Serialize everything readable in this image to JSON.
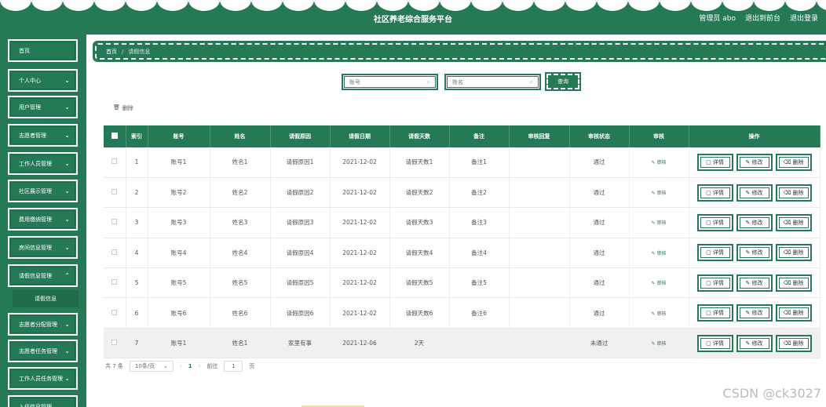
{
  "header": {
    "title": "社区养老综合服务平台",
    "user": "管理员 abo",
    "back": "退出到前台",
    "logout": "退出登录"
  },
  "sidebar": {
    "items": [
      {
        "label": "首页",
        "chev": ""
      },
      {
        "label": "个人中心",
        "chev": "⌄"
      },
      {
        "label": "用户管理",
        "chev": "⌄"
      },
      {
        "label": "志愿者管理",
        "chev": "⌄"
      },
      {
        "label": "工作人员管理",
        "chev": "⌄"
      },
      {
        "label": "社区展示管理",
        "chev": "⌄"
      },
      {
        "label": "费用缴纳管理",
        "chev": "⌄"
      },
      {
        "label": "房间信息管理",
        "chev": "⌄"
      },
      {
        "label": "请假信息管理",
        "chev": "⌃"
      },
      {
        "label": "志愿者分配管理",
        "chev": "⌄"
      },
      {
        "label": "志愿者任务管理",
        "chev": "⌄"
      },
      {
        "label": "工作人员任务管理",
        "chev": "⌄"
      },
      {
        "label": "入住信息管理",
        "chev": "⌄"
      }
    ],
    "sub": "请假信息"
  },
  "breadcrumb": {
    "home": "首页",
    "sep": "/",
    "current": "请假信息"
  },
  "search": {
    "account_placeholder": "账号",
    "name_placeholder": "姓名",
    "query": "查询",
    "delete": "删除"
  },
  "table": {
    "headers": [
      "",
      "索引",
      "账号",
      "姓名",
      "请假原因",
      "请假日期",
      "请假天数",
      "备注",
      "审核回复",
      "审核状态",
      "审核",
      "操作"
    ],
    "rows": [
      [
        "1",
        "账号1",
        "姓名1",
        "请假原因1",
        "2021-12-02",
        "请假天数1",
        "备注1",
        "",
        "通过"
      ],
      [
        "2",
        "账号2",
        "姓名2",
        "请假原因2",
        "2021-12-02",
        "请假天数2",
        "备注2",
        "",
        "通过"
      ],
      [
        "3",
        "账号3",
        "姓名3",
        "请假原因3",
        "2021-12-02",
        "请假天数3",
        "备注3",
        "",
        "通过"
      ],
      [
        "4",
        "账号4",
        "姓名4",
        "请假原因4",
        "2021-12-02",
        "请假天数4",
        "备注4",
        "",
        "通过"
      ],
      [
        "5",
        "账号5",
        "姓名5",
        "请假原因5",
        "2021-12-02",
        "请假天数5",
        "备注5",
        "",
        "通过"
      ],
      [
        "6",
        "账号6",
        "姓名6",
        "请假原因6",
        "2021-12-02",
        "请假天数6",
        "备注6",
        "",
        "通过"
      ],
      [
        "7",
        "账号1",
        "姓名1",
        "家里有事",
        "2021-12-06",
        "2天",
        "",
        "",
        "未通过"
      ]
    ],
    "audit_label": "审核",
    "detail": "详情",
    "edit": "修改",
    "delete": "删除"
  },
  "pager": {
    "total": "共 7 条",
    "size": "10条/页",
    "page": "1",
    "goto": "前往",
    "goto_value": "1",
    "unit": "页"
  },
  "watermark": "CSDN @ck3027",
  "colors": {
    "primary": "#247a55"
  }
}
